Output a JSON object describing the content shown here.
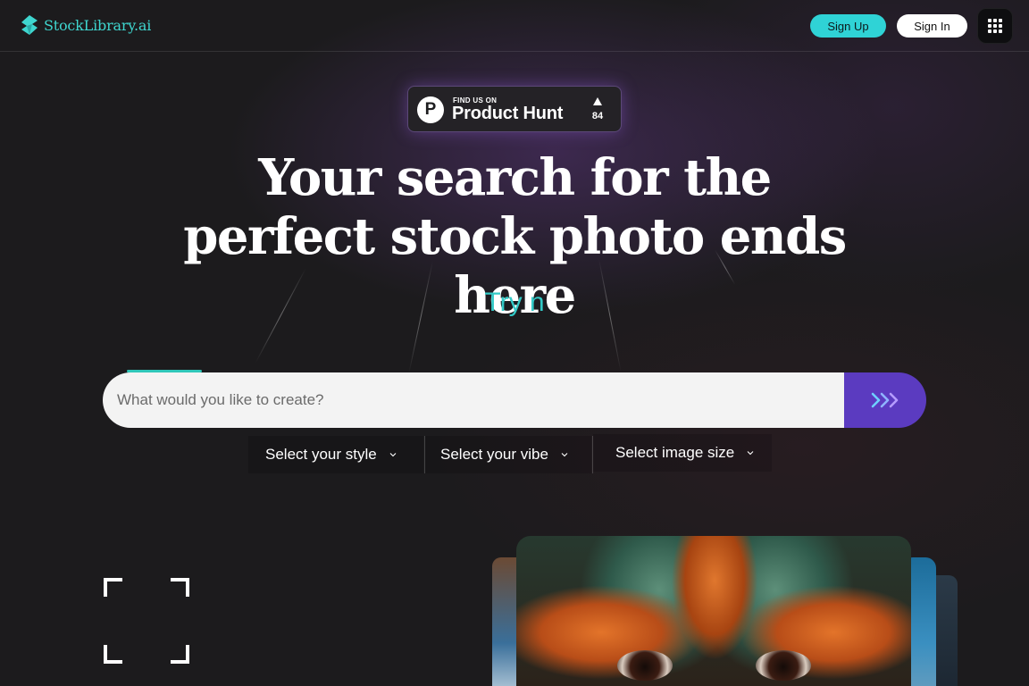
{
  "header": {
    "brand": "StockLibrary.ai",
    "signup_label": "Sign Up",
    "signin_label": "Sign In",
    "accent_color": "#2fd3d6"
  },
  "product_hunt": {
    "eyebrow": "FIND US ON",
    "name": "Product Hunt",
    "logo_letter": "P",
    "upvotes": "84"
  },
  "hero": {
    "headline_line1": "Your search for the",
    "headline_line2": "perfect stock photo ends here",
    "tagline": "Try n"
  },
  "search": {
    "placeholder": "What would you like to create?",
    "value": "",
    "submit_icon": "triple-chevron-right-icon",
    "submit_color": "#5b3bc0"
  },
  "filters": [
    {
      "label": "Select your style"
    },
    {
      "label": "Select your vibe"
    },
    {
      "label": "Select image size"
    }
  ]
}
